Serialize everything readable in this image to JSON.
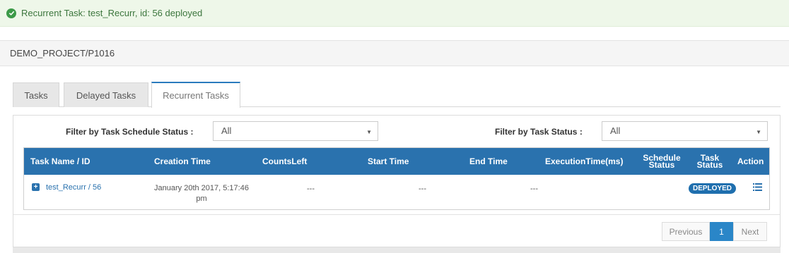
{
  "alert": {
    "message": "Recurrent Task: test_Recurr, id: 56 deployed",
    "icon": "check-circle-icon",
    "color": "#3c763d"
  },
  "project": {
    "path": "DEMO_PROJECT/P1016"
  },
  "tabs": [
    {
      "label": "Tasks",
      "active": false
    },
    {
      "label": "Delayed Tasks",
      "active": false
    },
    {
      "label": "Recurrent Tasks",
      "active": true
    }
  ],
  "filters": {
    "schedule_status_label": "Filter by Task Schedule Status :",
    "schedule_status_value": "All",
    "task_status_label": "Filter by Task Status :",
    "task_status_value": "All"
  },
  "table": {
    "headers": {
      "task_name": "Task Name / ID",
      "creation_time": "Creation Time",
      "counts_left": "CountsLeft",
      "start_time": "Start Time",
      "end_time": "End Time",
      "execution_time": "ExecutionTime(ms)",
      "schedule_status_line1": "Schedule",
      "schedule_status_line2": "Status",
      "task_status_line1": "Task",
      "task_status_line2": "Status",
      "action": "Action"
    },
    "rows": [
      {
        "task_name": "test_Recurr / 56",
        "creation_time_line1": "January 20th 2017, 5:17:46",
        "creation_time_line2": "pm",
        "counts_left": "---",
        "start_time": "---",
        "end_time": "---",
        "execution_time": "",
        "schedule_status": "",
        "task_status": "DEPLOYED",
        "action_icon": "list-icon"
      }
    ]
  },
  "pagination": {
    "previous": "Previous",
    "current": "1",
    "next": "Next"
  },
  "colors": {
    "header_blue": "#2a72ae",
    "accent": "#2a86c8",
    "success_bg": "#eef7e9"
  }
}
